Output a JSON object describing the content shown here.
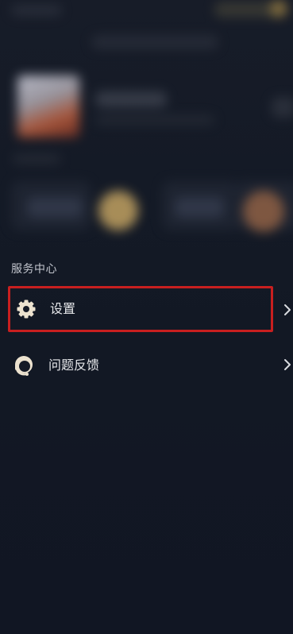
{
  "service_center": {
    "title": "服务中心",
    "items": [
      {
        "label": "设置",
        "icon": "gear-icon"
      },
      {
        "label": "问题反馈",
        "icon": "headset-icon"
      }
    ]
  },
  "colors": {
    "background": "#121722",
    "highlight_border": "#c81f1f",
    "icon": "#ece2cf",
    "text": "#e6e7ea"
  }
}
